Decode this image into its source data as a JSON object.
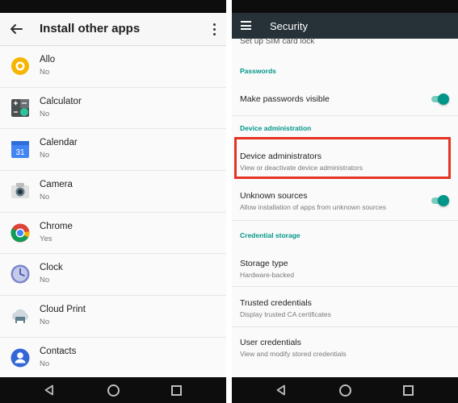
{
  "left": {
    "title": "Install other apps",
    "apps": [
      {
        "name": "Allo",
        "status": "No",
        "icon": "allo-icon"
      },
      {
        "name": "Calculator",
        "status": "No",
        "icon": "calculator-icon"
      },
      {
        "name": "Calendar",
        "status": "No",
        "icon": "calendar-icon",
        "icon_text": "31"
      },
      {
        "name": "Camera",
        "status": "No",
        "icon": "camera-icon"
      },
      {
        "name": "Chrome",
        "status": "Yes",
        "icon": "chrome-icon"
      },
      {
        "name": "Clock",
        "status": "No",
        "icon": "clock-icon"
      },
      {
        "name": "Cloud Print",
        "status": "No",
        "icon": "cloud-print-icon"
      },
      {
        "name": "Contacts",
        "status": "No",
        "icon": "contacts-icon"
      }
    ]
  },
  "right": {
    "title": "Security",
    "cut_off_item": "Set up SIM card lock",
    "sections": {
      "passwords": "Passwords",
      "device_admin": "Device administration",
      "credential_storage": "Credential storage"
    },
    "items": {
      "make_passwords_visible": {
        "title": "Make passwords visible",
        "toggle": "on"
      },
      "device_administrators": {
        "title": "Device administrators",
        "subtitle": "View or deactivate device administrators"
      },
      "unknown_sources": {
        "title": "Unknown sources",
        "subtitle": "Allow installation of apps from unknown sources",
        "toggle": "on"
      },
      "storage_type": {
        "title": "Storage type",
        "subtitle": "Hardware-backed"
      },
      "trusted_credentials": {
        "title": "Trusted credentials",
        "subtitle": "Display trusted CA certificates"
      },
      "user_credentials": {
        "title": "User credentials",
        "subtitle": "View and modify stored credentials"
      }
    }
  },
  "colors": {
    "accent": "#009688",
    "highlight": "#e53222",
    "appbar_dark": "#263238"
  }
}
